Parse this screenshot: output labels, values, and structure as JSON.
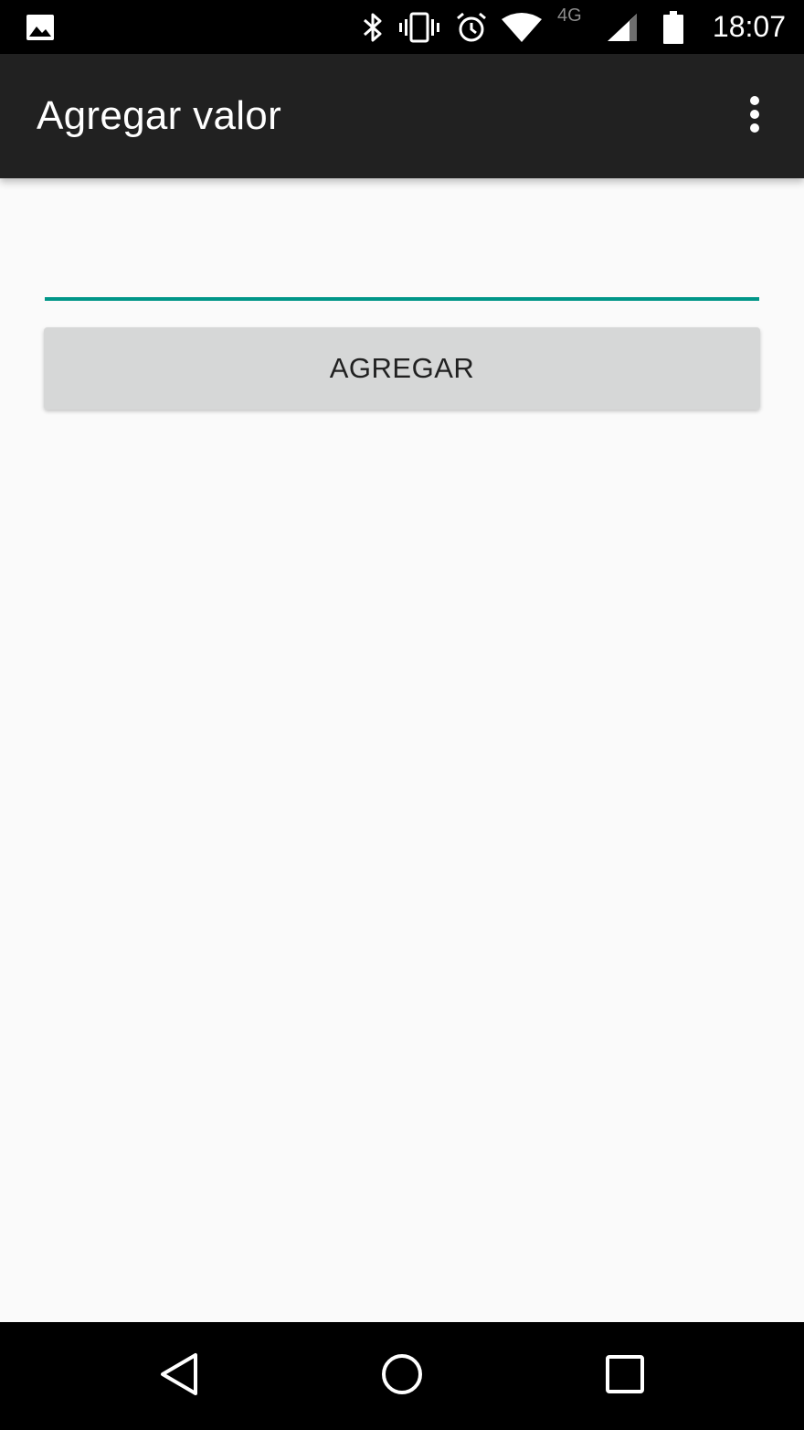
{
  "status_bar": {
    "time": "18:07",
    "network_type": "4G",
    "icons": [
      "image-icon",
      "bluetooth-icon",
      "vibrate-icon",
      "alarm-icon",
      "wifi-icon",
      "signal-icon",
      "battery-icon"
    ]
  },
  "app_bar": {
    "title": "Agregar valor",
    "overflow_icon": "more-vert-icon"
  },
  "form": {
    "input_value": "",
    "add_button_label": "AGREGAR"
  },
  "nav_bar": {
    "icons": [
      "back-icon",
      "home-icon",
      "recents-icon"
    ]
  },
  "colors": {
    "accent": "#009688",
    "app_bar": "#212121",
    "background": "#fafafa",
    "button": "#d6d7d7"
  }
}
